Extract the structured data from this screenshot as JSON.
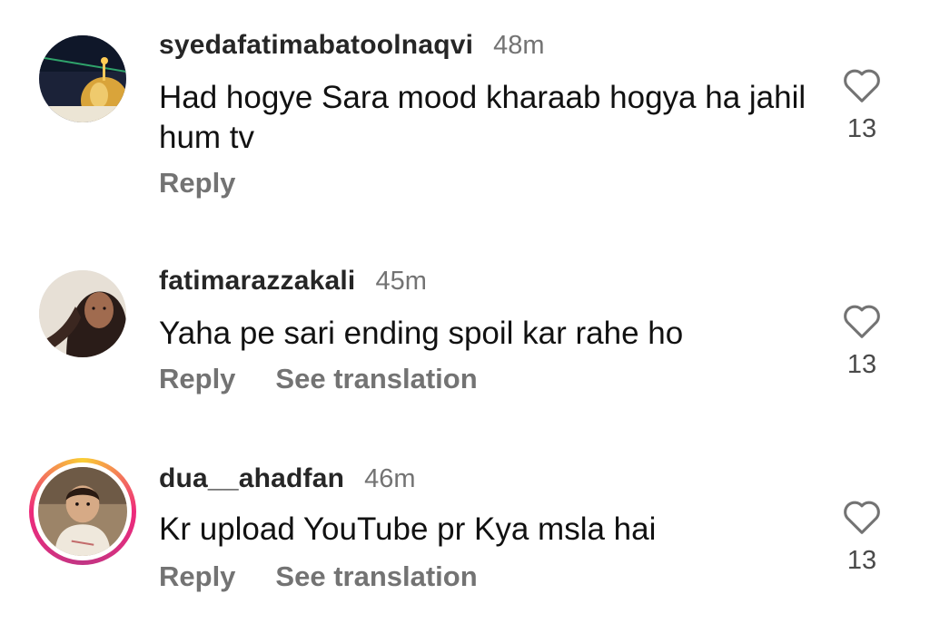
{
  "comments": [
    {
      "username": "syedafatimabatoolnaqvi",
      "time": "48m",
      "text": "Had hogye Sara mood kharaab hogya ha jahil hum tv",
      "reply_label": "Reply",
      "likes": "13",
      "avatar_icon": "shrine-dome-avatar"
    },
    {
      "username": "fatimarazzakali",
      "time": "45m",
      "text": "Yaha pe sari ending spoil kar rahe ho",
      "reply_label": "Reply",
      "translate_label": "See translation",
      "likes": "13",
      "avatar_icon": "person-avatar"
    },
    {
      "username": "dua__ahadfan",
      "time": "46m",
      "text": "Kr upload YouTube pr Kya msla hai",
      "reply_label": "Reply",
      "translate_label": "See translation",
      "likes": "13",
      "avatar_icon": "child-avatar",
      "has_story_ring": true
    }
  ],
  "colors": {
    "username": "#262626",
    "meta": "#737373",
    "text": "#111111",
    "story_ring": [
      "#f9ce34",
      "#ee2a7b",
      "#c13584"
    ]
  }
}
